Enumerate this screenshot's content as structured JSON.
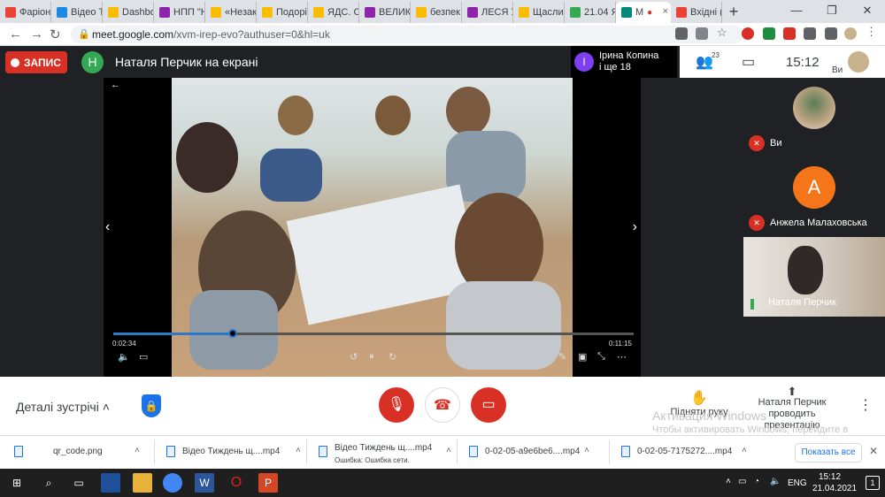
{
  "browser": {
    "tabs": [
      {
        "label": "Фаріон",
        "color": "#ea4335"
      },
      {
        "label": "Відео Т",
        "color": "#1e88e5"
      },
      {
        "label": "Dashbo",
        "color": "#fbbc04"
      },
      {
        "label": "НПП \"Н",
        "color": "#8e24aa"
      },
      {
        "label": "«Незак",
        "color": "#fbbc04"
      },
      {
        "label": "Подорі",
        "color": "#fbbc04"
      },
      {
        "label": "ЯДС. Сі",
        "color": "#fbbc04"
      },
      {
        "label": "ВЕЛИК",
        "color": "#8e24aa"
      },
      {
        "label": "безпек",
        "color": "#fbbc04"
      },
      {
        "label": "ЛЕСЯ У",
        "color": "#8e24aa"
      },
      {
        "label": "Щасли",
        "color": "#fbbc04"
      },
      {
        "label": "21.04 Я",
        "color": "#34a853"
      },
      {
        "label": "М",
        "color": "#00897b",
        "active": true
      },
      {
        "label": "Вхідні (",
        "color": "#ea4335"
      }
    ],
    "close_symbol": "×",
    "new_tab_symbol": "+",
    "window_controls": {
      "minimize": "—",
      "maximize": "❐",
      "close": "✕"
    },
    "url_host": "meet.google.com",
    "url_path": "/xvm-irep-evo?authuser=0&hl=uk"
  },
  "meet": {
    "record_label": "ЗАПИС",
    "presenter_initial": "Н",
    "presenter_title": "Наталя Перчик на екрані",
    "participant_initial": "І",
    "participant_name": "Ірина Копина",
    "participant_more": "і ще 18",
    "people_count": "23",
    "time": "15:12",
    "self_short": "Ви",
    "video": {
      "current_time": "0:02:34",
      "duration": "0:11:15",
      "progress": 0.23
    },
    "tiles": [
      {
        "name": "Ви"
      },
      {
        "name": "Анжела Малаховська",
        "initial": "А"
      },
      {
        "name": "Наталя Перчик"
      }
    ],
    "details_label": "Деталі зустрічі",
    "raise_hand_label": "Підняти руку",
    "present_label_1": "Наталя Перчик",
    "present_label_2": "проводить презентацію",
    "watermark_title": "Активация Windows",
    "watermark_text": "Чтобы активировать Windows, перейдите в раздел \"Параметры\"."
  },
  "downloads": {
    "items": [
      {
        "name": "qr_code.png",
        "status": ""
      },
      {
        "name": "Відео Тиждень щ....mp4",
        "status": ""
      },
      {
        "name": "Відео Тиждень щ....mp4",
        "status": "Ошибка: Ошибка сети."
      },
      {
        "name": "0-02-05-a9e6be6....mp4",
        "status": ""
      },
      {
        "name": "0-02-05-7175272....mp4",
        "status": ""
      }
    ],
    "show_all": "Показать все"
  },
  "taskbar": {
    "lang": "ENG",
    "time": "15:12",
    "date": "21.04.2021",
    "notifications": "1"
  }
}
